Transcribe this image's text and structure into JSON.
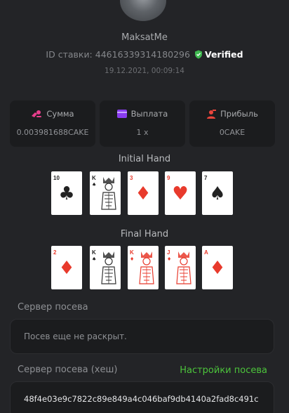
{
  "user": {
    "name": "MaksatMe"
  },
  "bet": {
    "id_label": "ID ставки:",
    "id_value": "44616339314180296",
    "verified_label": "Verified",
    "date": "19.12.2021, 00:09:14"
  },
  "stats": [
    {
      "icon": "coins-icon",
      "label": "Сумма",
      "value": "0.003981688CAKE",
      "color": "#e83e8c"
    },
    {
      "icon": "wallet-icon",
      "label": "Выплата",
      "value": "1 x",
      "color": "#8a3cf0"
    },
    {
      "icon": "user-profit-icon",
      "label": "Прибыль",
      "value": "0CAKE",
      "color": "#e8453c"
    }
  ],
  "initial_hand": {
    "title": "Initial Hand",
    "cards": [
      {
        "rank": "10",
        "suit": "clubs",
        "color": "black"
      },
      {
        "rank": "K",
        "suit": "spades",
        "color": "black"
      },
      {
        "rank": "3",
        "suit": "diamonds",
        "color": "red"
      },
      {
        "rank": "9",
        "suit": "hearts",
        "color": "red"
      },
      {
        "rank": "7",
        "suit": "spades",
        "color": "black"
      }
    ]
  },
  "final_hand": {
    "title": "Final Hand",
    "cards": [
      {
        "rank": "2",
        "suit": "diamonds",
        "color": "red"
      },
      {
        "rank": "K",
        "suit": "spades",
        "color": "black"
      },
      {
        "rank": "K",
        "suit": "diamonds",
        "color": "red"
      },
      {
        "rank": "J",
        "suit": "diamonds",
        "color": "red"
      },
      {
        "rank": "A",
        "suit": "diamonds",
        "color": "red"
      }
    ]
  },
  "seed_server": {
    "label": "Сервер посева",
    "value": "Посев еще не раскрыт."
  },
  "seed_hash": {
    "label": "Сервер посева (хеш)",
    "settings_link": "Настройки посева",
    "value": "48f4e03e9c7822c89e849a4c046baf9db4140a2fad8c491c"
  },
  "colors": {
    "accent_green": "#4cc43b",
    "verified_shield": "#3fb950",
    "card_red": "#e83a2c"
  }
}
